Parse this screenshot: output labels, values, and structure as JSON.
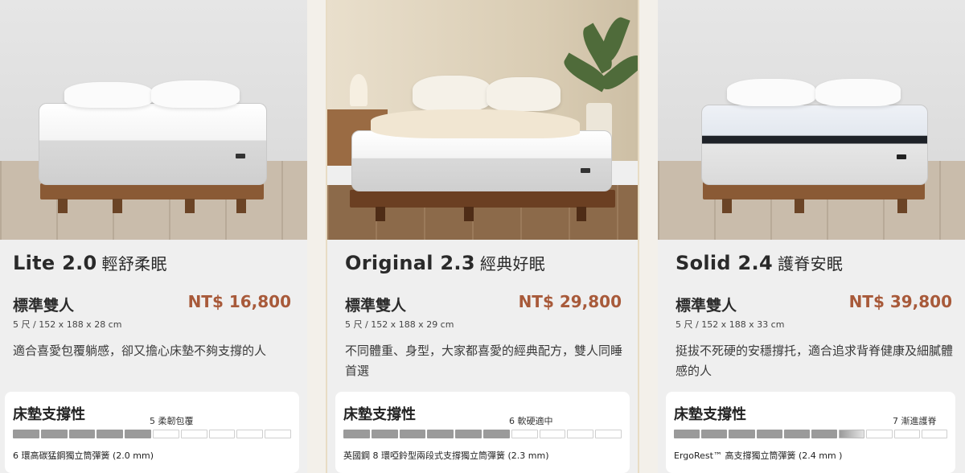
{
  "products": [
    {
      "name": "Lite 2.0",
      "name_cn": "輕舒柔眠",
      "size_name": "標準雙人",
      "price": "NT$ 16,800",
      "dims": "5 尺 / 152 x 188 x 28 cm",
      "description": "適合喜愛包覆躺感，卻又擔心床墊不夠支撐的人",
      "support_title": "床墊支撐性",
      "support_level_label": "5 柔韌包覆",
      "support_level": 5,
      "support_max": 10,
      "spring": "6 環高碳猛鋼獨立筒彈簧 (2.0 mm)"
    },
    {
      "name": "Original 2.3",
      "name_cn": "經典好眠",
      "size_name": "標準雙人",
      "price": "NT$ 29,800",
      "dims": "5 尺 / 152 x 188 x 29 cm",
      "description": "不同體重、身型，大家都喜愛的經典配方，雙人同睡首選",
      "support_title": "床墊支撐性",
      "support_level_label": "6 軟硬適中",
      "support_level": 6,
      "support_max": 10,
      "spring": "英國鋼 8 環啞鈴型兩段式支撐獨立筒彈簧 (2.3 mm)"
    },
    {
      "name": "Solid 2.4",
      "name_cn": "護脊安眠",
      "size_name": "標準雙人",
      "price": "NT$ 39,800",
      "dims": "5 尺 / 152 x 188 x 33 cm",
      "description": "挺拔不死硬的安穩撐托，適合追求背脊健康及細膩體感的人",
      "support_title": "床墊支撐性",
      "support_level_label": "7 漸進護脊",
      "support_level": 7,
      "support_max": 10,
      "spring": "ErgoRest™ 高支撐獨立筒彈簧 (2.4 mm )"
    }
  ],
  "colors": {
    "price": "#a85a3a",
    "bar_on": "#9a9a9a",
    "card_bg": "#efefef"
  }
}
